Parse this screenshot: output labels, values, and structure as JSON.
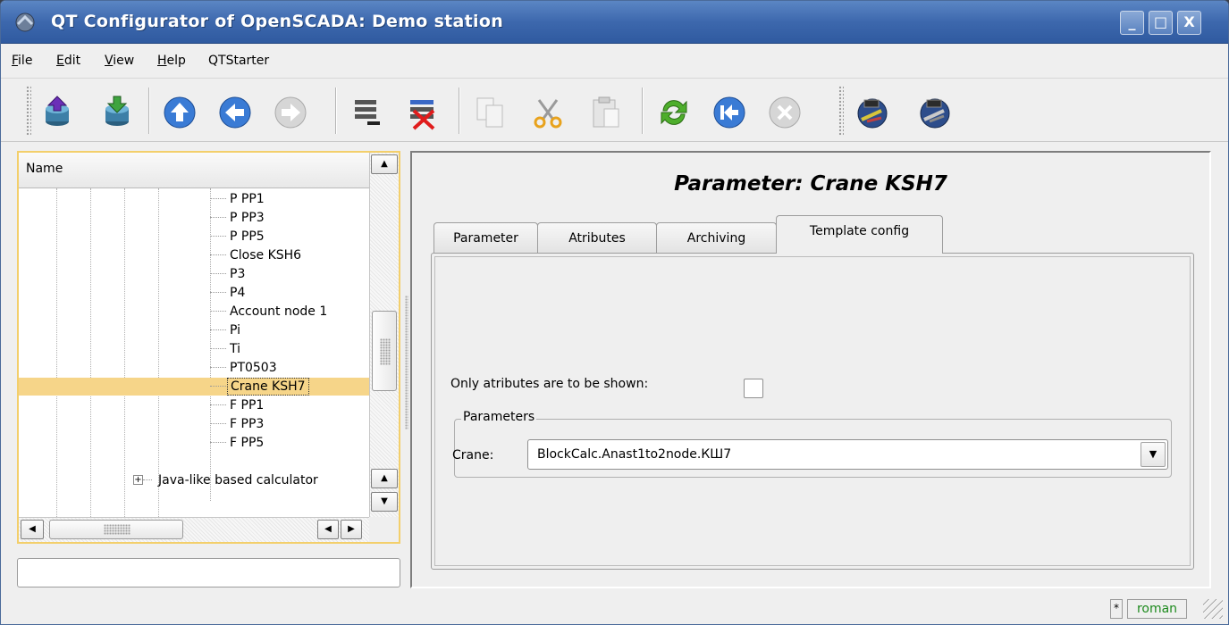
{
  "window": {
    "title": "QT Configurator of OpenSCADA: Demo station",
    "buttons": [
      "_",
      "□",
      "X"
    ]
  },
  "menu": [
    {
      "label": "File",
      "mnemonic": "F",
      "rest": "ile"
    },
    {
      "label": "Edit",
      "mnemonic": "E",
      "rest": "dit"
    },
    {
      "label": "View",
      "mnemonic": "V",
      "rest": "iew"
    },
    {
      "label": "Help",
      "mnemonic": "H",
      "rest": "elp"
    },
    {
      "label": "QTStarter",
      "mnemonic": "",
      "rest": "QTStarter"
    }
  ],
  "toolbar": {
    "icons": [
      "db-load-icon",
      "db-save-icon",
      "up-icon",
      "back-icon",
      "forward-icon",
      "add-item-icon",
      "delete-item-icon",
      "copy-icon",
      "cut-icon",
      "paste-icon",
      "refresh-icon",
      "start-icon",
      "stop-icon",
      "plugin-icon-1",
      "plugin-icon-2"
    ]
  },
  "tree": {
    "header": "Name",
    "items": [
      {
        "label": "P PP1"
      },
      {
        "label": "P PP3"
      },
      {
        "label": "P PP5"
      },
      {
        "label": "Close KSH6"
      },
      {
        "label": "P3"
      },
      {
        "label": "P4"
      },
      {
        "label": "Account node 1"
      },
      {
        "label": "Pi"
      },
      {
        "label": "Ti"
      },
      {
        "label": "PT0503"
      },
      {
        "label": "Crane KSH7",
        "selected": true
      },
      {
        "label": "F PP1"
      },
      {
        "label": "F PP3"
      },
      {
        "label": "F PP5"
      }
    ],
    "next_group": "Java-like based calculator",
    "expander": "+"
  },
  "page": {
    "title": "Parameter: Crane KSH7",
    "tabs": [
      {
        "label": "Parameter"
      },
      {
        "label": "Atributes"
      },
      {
        "label": "Archiving"
      },
      {
        "label": "Template config",
        "active": true
      }
    ],
    "only_attributes_label": "Only atributes are to be shown:",
    "only_attributes_checked": false,
    "group_title": "Parameters",
    "crane_label": "Crane:",
    "crane_value": "BlockCalc.Anast1to2node.КШ7"
  },
  "status": {
    "modified": "*",
    "user": "roman"
  },
  "colors": {
    "title_bar": "#3d68ad",
    "selection": "#f6d589",
    "focus_frame": "#f3cf6b",
    "user_text": "#1d8a1d"
  }
}
